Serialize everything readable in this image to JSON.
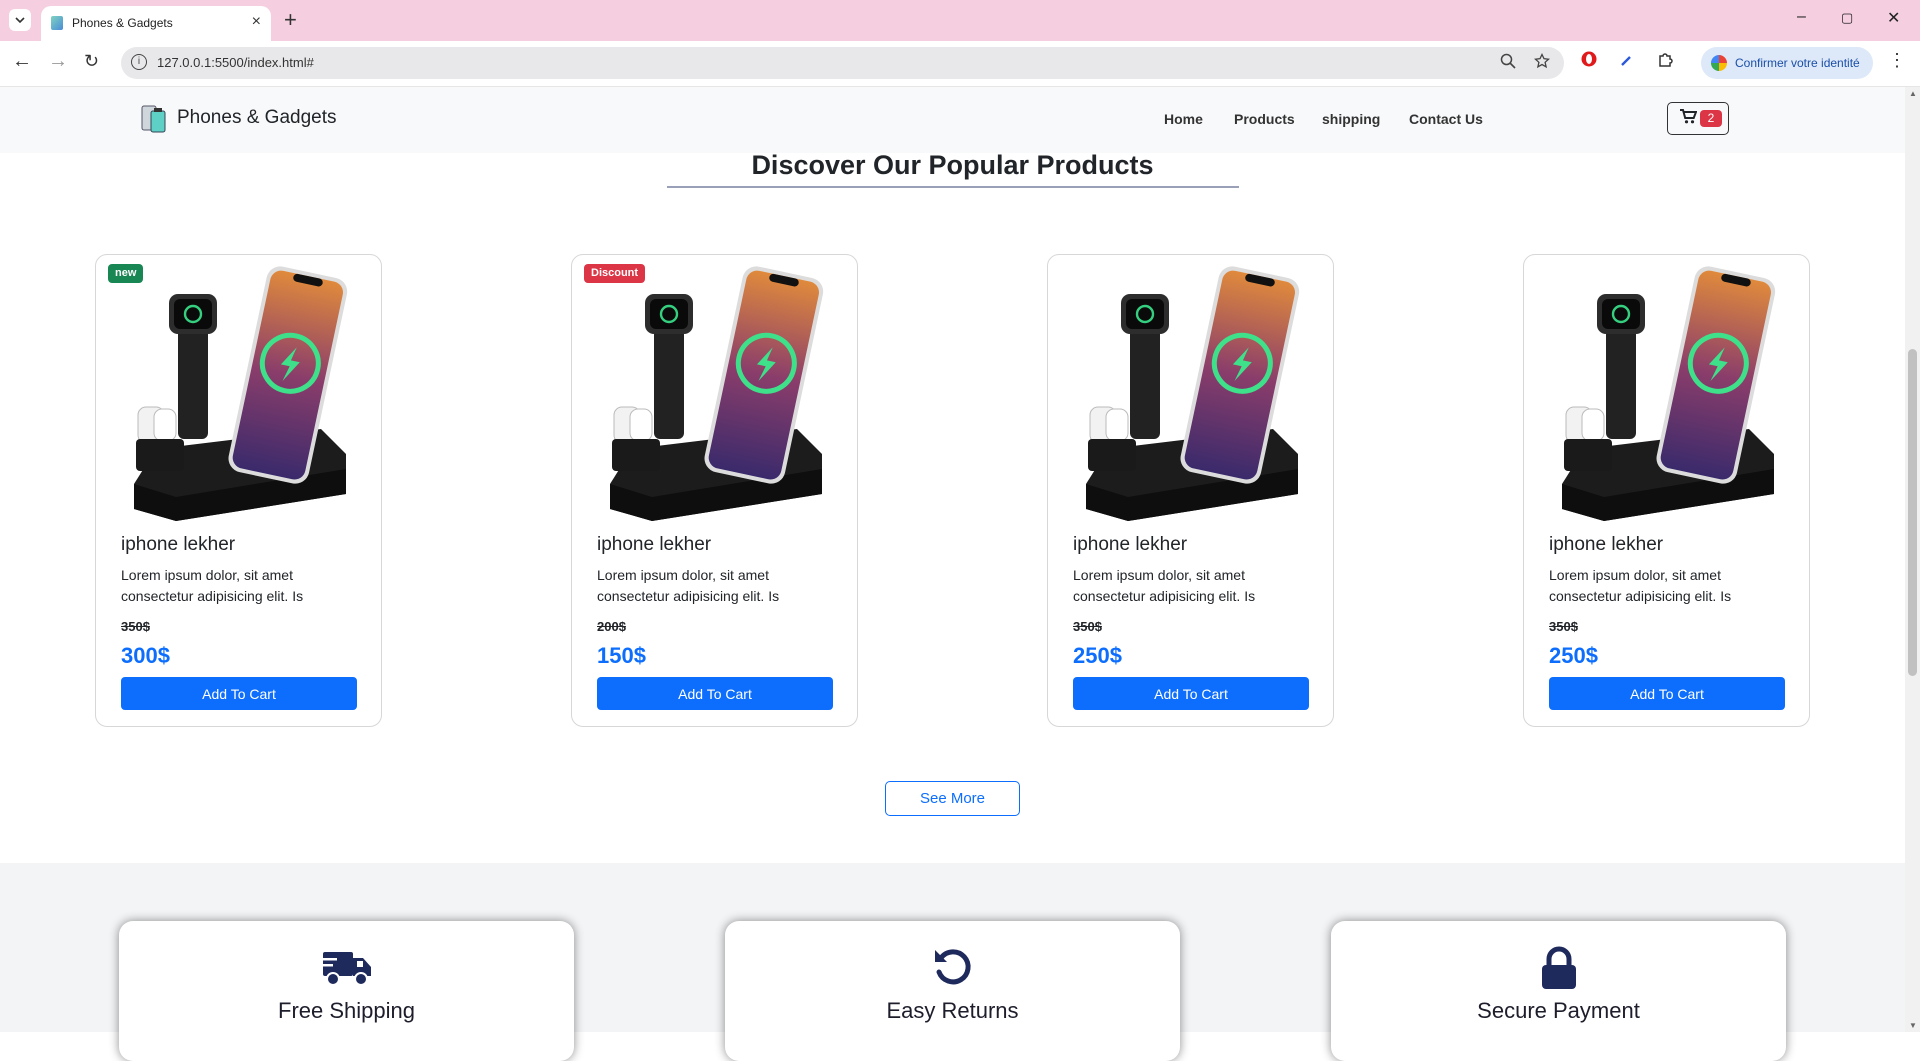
{
  "browser": {
    "tab_title": "Phones & Gadgets",
    "new_tab_glyph": "+",
    "url": "127.0.0.1:5500/index.html#",
    "profile_label": "Confirmer votre identité",
    "window_controls": [
      "–",
      "▢",
      "✕"
    ]
  },
  "navbar": {
    "brand": "Phones & Gadgets",
    "links": [
      "Home",
      "Products",
      "shipping",
      "Contact Us"
    ],
    "cart_count": "2"
  },
  "section": {
    "title": "Discover Our Popular Products"
  },
  "products": [
    {
      "badge": "new",
      "badge_color": "#198754",
      "name": "iphone lekher",
      "description": "Lorem ipsum dolor, sit amet consectetur adipisicing elit. Is",
      "old_price": "350$",
      "price": "300$",
      "button": "Add To Cart"
    },
    {
      "badge": "Discount",
      "badge_color": "#dc3545",
      "name": "iphone lekher",
      "description": "Lorem ipsum dolor, sit amet consectetur adipisicing elit. Is",
      "old_price": "200$",
      "price": "150$",
      "button": "Add To Cart"
    },
    {
      "badge": "",
      "name": "iphone lekher",
      "description": "Lorem ipsum dolor, sit amet consectetur adipisicing elit. Is",
      "old_price": "350$",
      "price": "250$",
      "button": "Add To Cart"
    },
    {
      "badge": "",
      "name": "iphone lekher",
      "description": "Lorem ipsum dolor, sit amet consectetur adipisicing elit. Is",
      "old_price": "350$",
      "price": "250$",
      "button": "Add To Cart"
    }
  ],
  "see_more": "See More",
  "features": [
    {
      "icon": "truck-icon",
      "title": "Free Shipping"
    },
    {
      "icon": "rotate-left-icon",
      "title": "Easy Returns"
    },
    {
      "icon": "lock-icon",
      "title": "Secure Payment"
    }
  ],
  "colors": {
    "primary": "#0d6efd",
    "danger": "#dc3545",
    "success": "#198754",
    "tabbar": "#f5cfe0",
    "feature_icon": "#1f2a5c"
  }
}
